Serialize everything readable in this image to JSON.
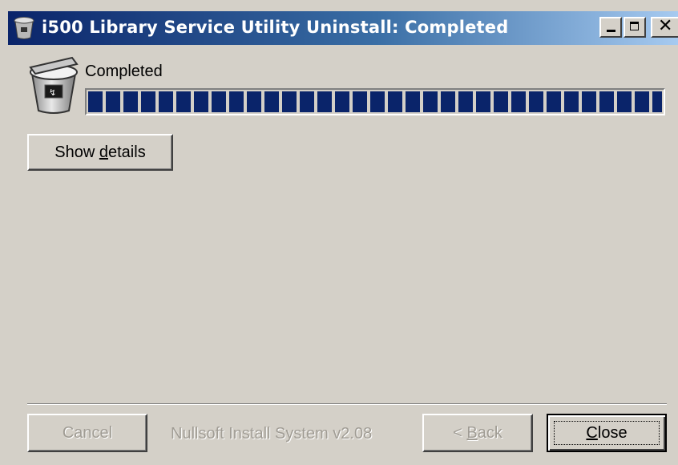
{
  "window": {
    "title": "i500 Library Service Utility Uninstall: Completed",
    "icon": "trash-app-icon",
    "controls": {
      "minimize": "_",
      "maximize": "□",
      "close": "✕"
    }
  },
  "status": {
    "text": "Completed",
    "icon": "recycle-bin-icon",
    "progress_percent": 100
  },
  "details_button": {
    "pre": "Show ",
    "mnemonic": "d",
    "post": "etails"
  },
  "footer": {
    "cancel_label": "Cancel",
    "branding": "Nullsoft Install System v2.08",
    "back": {
      "pre": "< ",
      "mnemonic": "B",
      "post": "ack"
    },
    "close": {
      "mnemonic": "C",
      "post": "lose"
    }
  },
  "colors": {
    "title_gradient_start": "#0a246a",
    "title_gradient_end": "#a6caf0",
    "progress_fill": "#0a246a",
    "face": "#d4d0c8"
  }
}
